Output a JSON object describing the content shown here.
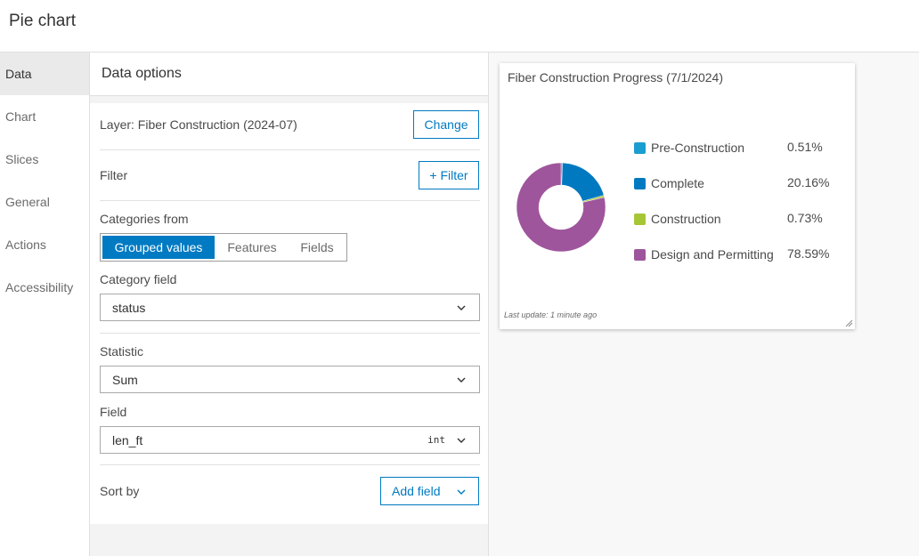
{
  "header": {
    "title": "Pie chart"
  },
  "sidebar": {
    "items": [
      {
        "label": "Data",
        "active": true
      },
      {
        "label": "Chart"
      },
      {
        "label": "Slices"
      },
      {
        "label": "General"
      },
      {
        "label": "Actions"
      },
      {
        "label": "Accessibility"
      }
    ]
  },
  "panel": {
    "title": "Data options",
    "layer_label": "Layer: Fiber Construction (2024-07)",
    "change_label": "Change",
    "filter_label": "Filter",
    "add_filter_label": "+ Filter",
    "categories_from_label": "Categories from",
    "segments": [
      "Grouped values",
      "Features",
      "Fields"
    ],
    "selected_segment": "Grouped values",
    "category_field_label": "Category field",
    "category_field_value": "status",
    "statistic_label": "Statistic",
    "statistic_value": "Sum",
    "field_label": "Field",
    "field_value": "len_ft",
    "field_type_tag": "int",
    "sort_by_label": "Sort by",
    "add_field_label": "Add field"
  },
  "card": {
    "title": "Fiber Construction Progress (7/1/2024)",
    "footer": "Last update: 1 minute ago"
  },
  "colors": {
    "accent": "#007ac2",
    "pre_construction": "#1a9ed0",
    "complete": "#0079c1",
    "construction": "#a7c636",
    "design_permitting": "#9e559c"
  },
  "chart_data": {
    "type": "pie",
    "donut": true,
    "title": "Fiber Construction Progress (7/1/2024)",
    "legend_placement": "right",
    "categories": [
      "Pre-Construction",
      "Complete",
      "Construction",
      "Design and Permitting"
    ],
    "values": [
      0.51,
      20.16,
      0.73,
      78.59
    ],
    "value_labels": [
      "0.51%",
      "20.16%",
      "0.73%",
      "78.59%"
    ],
    "colors": [
      "#1a9ed0",
      "#0079c1",
      "#a7c636",
      "#9e559c"
    ]
  }
}
